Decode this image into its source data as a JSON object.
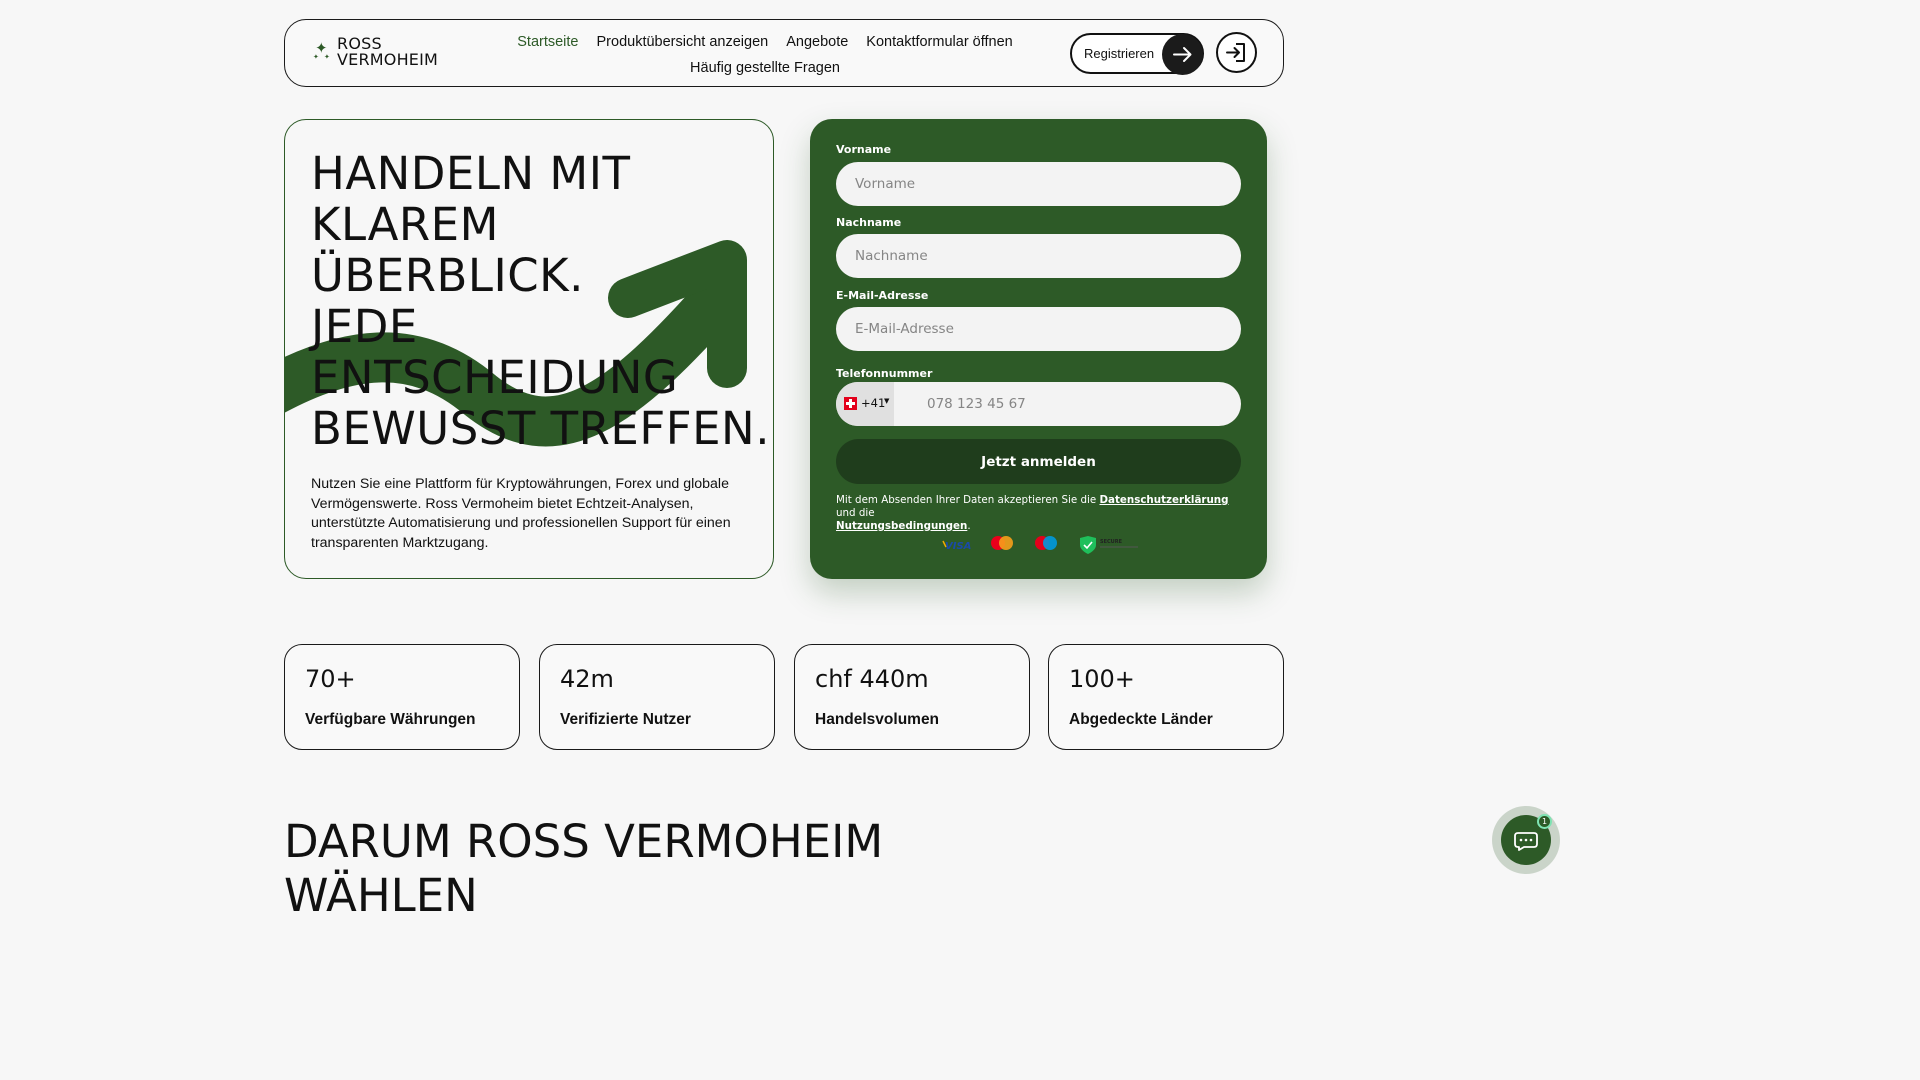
{
  "header": {
    "logo_line1": "ROSS",
    "logo_line2": "VERMOHEIM",
    "nav": [
      "Startseite",
      "Produktübersicht anzeigen",
      "Angebote",
      "Kontaktformular öffnen",
      "Häufig gestellte Fragen"
    ],
    "active_nav": "Startseite",
    "register_label": "Registrieren"
  },
  "hero": {
    "title_lines": [
      "HANDELN MIT",
      "KLAREM ÜBERBLICK.",
      "JEDE ENTSCHEIDUNG",
      "BEWUSST TREFFEN."
    ],
    "text": "Nutzen Sie eine Plattform für Kryptowährungen, Forex und globale Vermögenswerte. Ross Vermoheim bietet Echtzeit-Analysen, unterstützte Automatisierung und professionellen Support für einen transparenten Marktzugang."
  },
  "form": {
    "first_name": {
      "label": "Vorname",
      "placeholder": "Vorname",
      "value": ""
    },
    "last_name": {
      "label": "Nachname",
      "placeholder": "Nachname",
      "value": ""
    },
    "email": {
      "label": "E-Mail-Adresse",
      "placeholder": "E-Mail-Adresse",
      "value": ""
    },
    "phone": {
      "label": "Telefonnummer",
      "country_code": "+41",
      "placeholder": "078 123 45 67",
      "value": ""
    },
    "submit_label": "Jetzt anmelden",
    "legal_prefix": "Mit dem Absenden Ihrer Daten akzeptieren Sie die ",
    "privacy_link": "Datenschutzerklärung",
    "legal_middle": " und die ",
    "terms_link": "Nutzungsbedingungen",
    "legal_suffix": ".",
    "payment_icons": [
      "visa-icon",
      "mastercard-icon",
      "maestro-icon",
      "secure-shield-icon"
    ],
    "payment_visa": "VISA",
    "payment_secure": "SECURE"
  },
  "stats": [
    {
      "value": "70+",
      "label": "Verfügbare Währungen"
    },
    {
      "value": "42m",
      "label": "Verifizierte Nutzer"
    },
    {
      "value": "chf 440m",
      "label": "Handelsvolumen"
    },
    {
      "value": "100+",
      "label": "Abgedeckte Länder"
    }
  ],
  "section_title": "DARUM ROSS VERMOHEIM WÄHLEN",
  "chat": {
    "badge": "1"
  },
  "colors": {
    "brand_green": "#2d5a27",
    "dark_green": "#1f3d1c",
    "background": "#f7f7f7"
  }
}
